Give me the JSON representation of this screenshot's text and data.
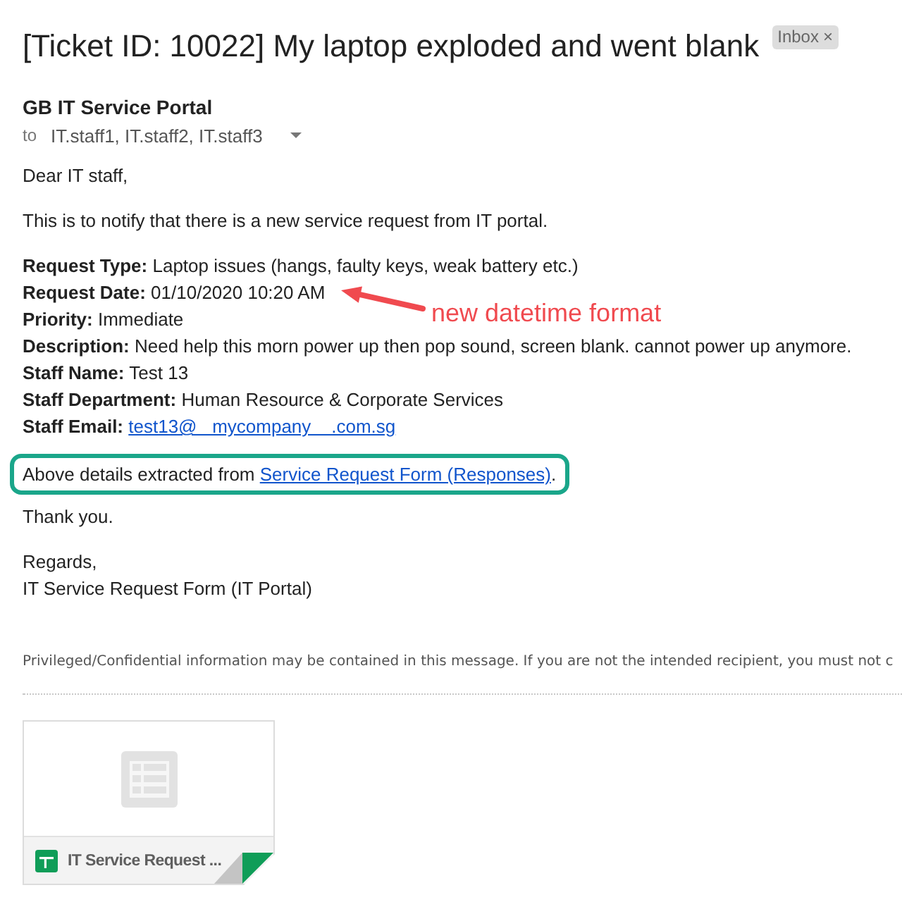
{
  "email": {
    "subject": "[Ticket ID: 10022] My laptop exploded and went blank",
    "label": {
      "text": "Inbox",
      "remove": "×"
    }
  },
  "sender": {
    "name": "GB IT Service Portal",
    "to_label": "to",
    "recipients": "IT.staff1, IT.staff2, IT.staff3"
  },
  "body": {
    "greeting": "Dear IT staff,",
    "intro": "This is to notify that there is a new service request from IT portal.",
    "fields": [
      {
        "kind": "text",
        "label": "Request Type:",
        "value": "Laptop issues (hangs, faulty keys, weak battery etc.)"
      },
      {
        "kind": "text",
        "label": "Request Date:",
        "value": "01/10/2020 10:20 AM"
      },
      {
        "kind": "text",
        "label": "Priority:",
        "value": "Immediate"
      },
      {
        "kind": "text",
        "label": "Description:",
        "value": "Need help this morn power up then pop sound, screen blank. cannot power up anymore."
      },
      {
        "kind": "text",
        "label": "Staff Name:",
        "value": "Test 13"
      },
      {
        "kind": "text",
        "label": "Staff Department:",
        "value": "Human Resource & Corporate Services"
      },
      {
        "kind": "link",
        "label": "Staff Email:",
        "value": "test13@   mycompany    .com.sg"
      }
    ],
    "source": {
      "text": "Above details extracted from ",
      "link": "Service Request Form (Responses)",
      "end": ".",
      "highlighted": true
    },
    "thanks": "Thank you.",
    "closing": "Regards,",
    "signature": "IT Service Request Form (IT Portal)"
  },
  "disclaimer": "Privileged/Confidential information may be contained in this message. If you are not the intended recipient, you must not c",
  "attachment": {
    "name": "IT Service Request ..."
  },
  "annotations": [
    {
      "text": "new datetime format"
    }
  ]
}
